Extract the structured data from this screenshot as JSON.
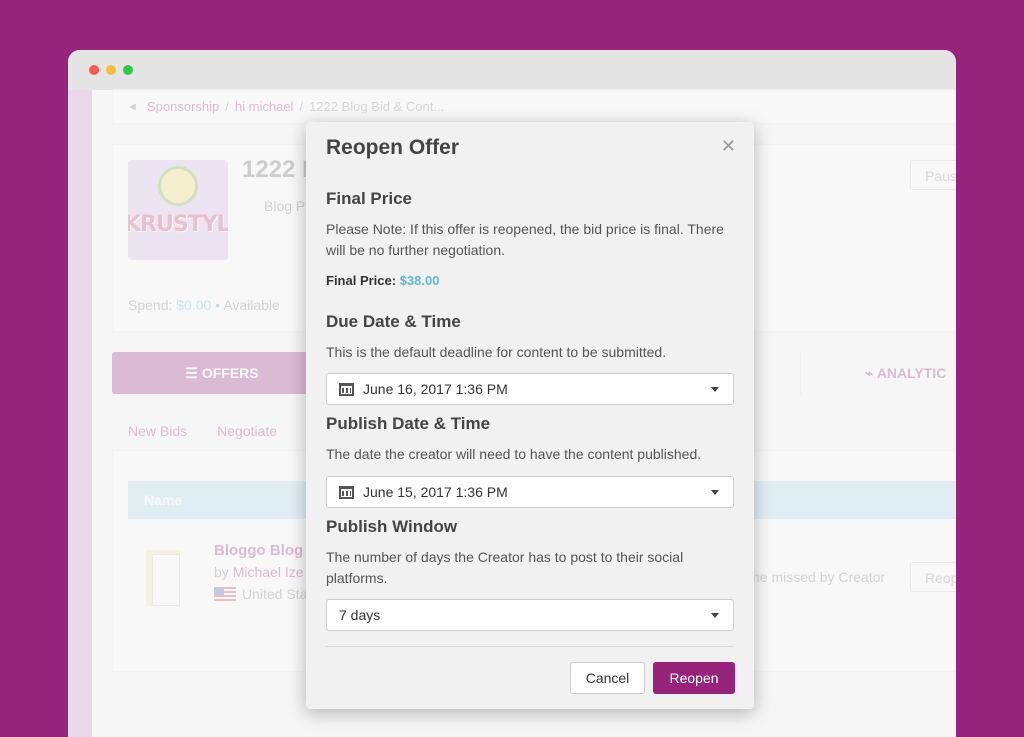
{
  "background": {
    "breadcrumb": [
      "Sponsorship",
      "hi michael",
      "1222 Blog Bid & Cont..."
    ],
    "campaign_title": "1222 B",
    "campaign_subtitle": "Blog P",
    "spend_label": "Spend:",
    "spend_value": "$0.00",
    "available_label": "Available",
    "pause_label": "Paus",
    "logo_text": "KRUSTYLAN",
    "tabs": {
      "offers": "OFFERS",
      "analytics": "ANALYTIC"
    },
    "subtabs": [
      "New Bids",
      "Negotiate"
    ],
    "table_header": "Name",
    "row": {
      "title": "Bloggo Blog",
      "by_label": "by",
      "author": "Michael Ize",
      "location": "United Sta",
      "status": "ne missed by Creator",
      "action": "Reop"
    }
  },
  "modal": {
    "title": "Reopen Offer",
    "final_price": {
      "heading": "Final Price",
      "note": "Please Note: If this offer is reopened, the bid price is final. There will be no further negotiation.",
      "label": "Final Price:",
      "value": "$38.00"
    },
    "due_date": {
      "heading": "Due Date & Time",
      "description": "This is the default deadline for content to be submitted.",
      "value": "June 16, 2017 1:36 PM"
    },
    "publish_date": {
      "heading": "Publish Date & Time",
      "description": "The date the creator will need to have the content published.",
      "value": "June 15, 2017 1:36 PM"
    },
    "publish_window": {
      "heading": "Publish Window",
      "description": "The number of days the Creator has to post to their social platforms.",
      "value": "7 days"
    },
    "cancel_label": "Cancel",
    "reopen_label": "Reopen"
  },
  "colors": {
    "brand": "#96247a",
    "price": "#5fb8d8",
    "table_header": "#a8dbf0"
  }
}
